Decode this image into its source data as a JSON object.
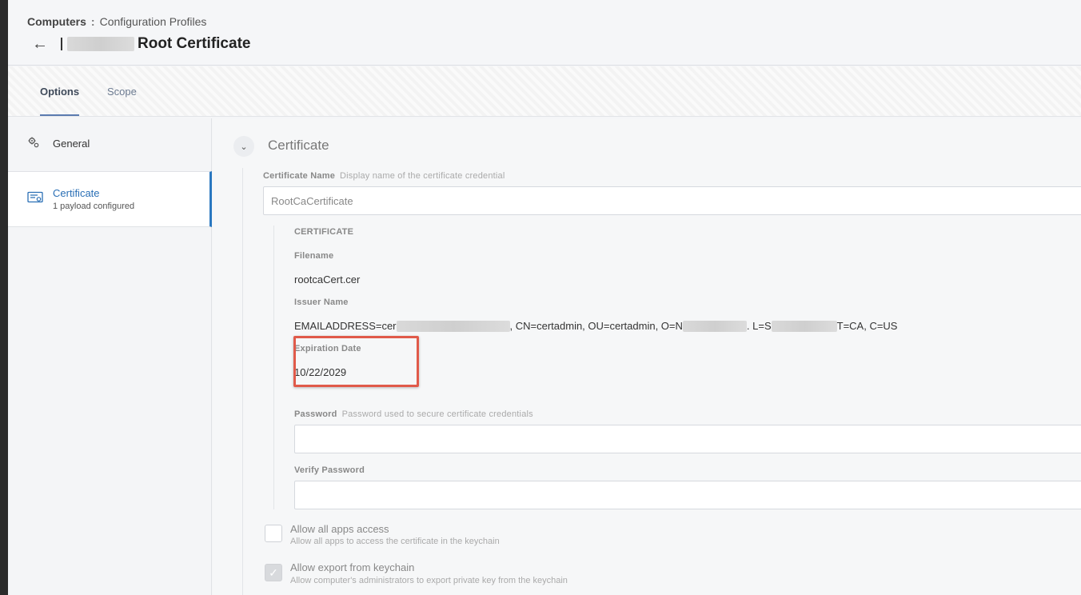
{
  "breadcrumb": {
    "root": "Computers",
    "separator": ":",
    "current": "Configuration Profiles"
  },
  "header": {
    "title": "Root Certificate"
  },
  "tabs": [
    {
      "label": "Options"
    },
    {
      "label": "Scope"
    }
  ],
  "sidebar": {
    "items": [
      {
        "label": "General",
        "icon": "gears-icon"
      },
      {
        "label": "Certificate",
        "sublabel": "1 payload configured",
        "icon": "certificate-icon"
      }
    ]
  },
  "section": {
    "title": "Certificate"
  },
  "certificate_name": {
    "label": "Certificate Name",
    "hint": "Display name of the certificate credential",
    "value": "RootCaCertificate"
  },
  "certificate": {
    "heading": "CERTIFICATE",
    "filename_label": "Filename",
    "filename": "rootcaCert.cer",
    "issuer_label": "Issuer Name",
    "issuer_part1": "EMAILADDRESS=cer",
    "issuer_part2": ", CN=certadmin, OU=certadmin, O=N",
    "issuer_part3": ". L=S",
    "issuer_part4": "T=CA, C=US",
    "expiration_label": "Expiration Date",
    "expiration": "10/22/2029"
  },
  "password": {
    "label": "Password",
    "hint": "Password used to secure certificate credentials",
    "value": ""
  },
  "verify_password": {
    "label": "Verify Password",
    "value": ""
  },
  "allow_all_apps": {
    "label": "Allow all apps access",
    "description": "Allow all apps to access the certificate in the keychain",
    "checked": false
  },
  "allow_export": {
    "label": "Allow export from keychain",
    "description": "Allow computer's administrators to export private key from the keychain",
    "checked": true
  },
  "colors": {
    "accent": "#2a78c0",
    "highlight": "#e05a4a"
  }
}
